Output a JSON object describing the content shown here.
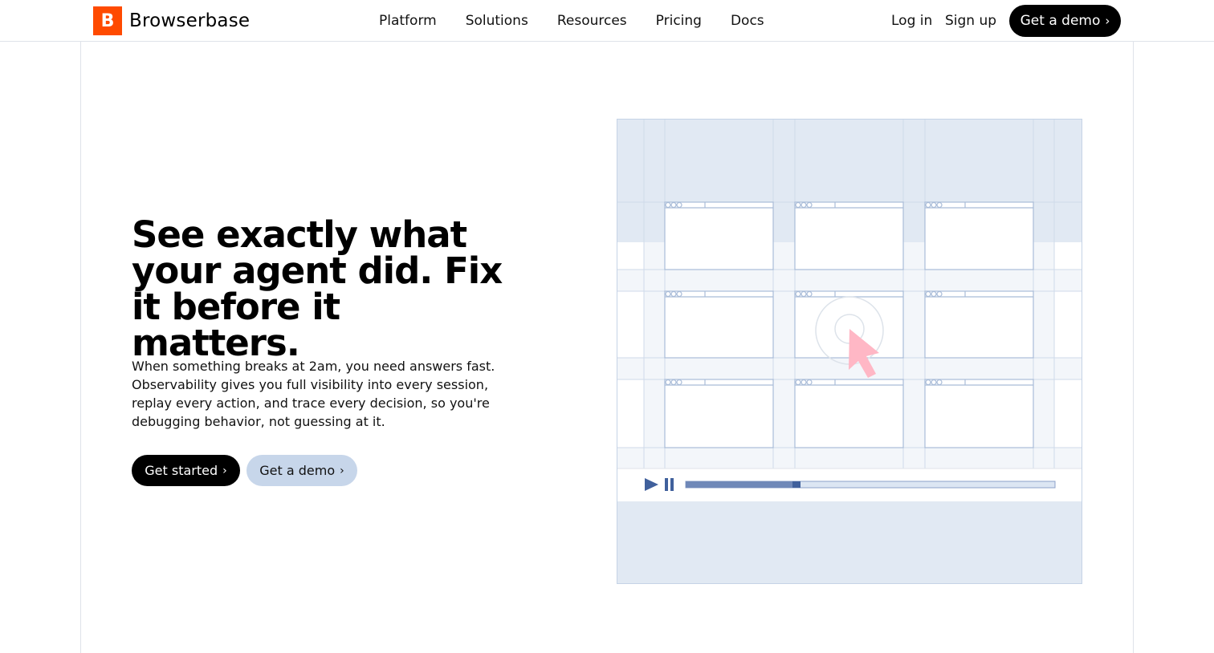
{
  "brand": {
    "mark": "B",
    "name": "Browserbase",
    "accent": "#ff4a00"
  },
  "nav": {
    "items": [
      {
        "label": "Platform"
      },
      {
        "label": "Solutions"
      },
      {
        "label": "Resources"
      },
      {
        "label": "Pricing"
      },
      {
        "label": "Docs"
      }
    ],
    "login_label": "Log in",
    "signup_label": "Sign up",
    "demo_label": "Get a demo"
  },
  "hero": {
    "headline": "See exactly what your agent did. Fix it before it matters.",
    "body": "When something breaks at 2am, you need answers fast. Observability gives you full visibility into every session, replay every action, and trace every decision, so you're debugging behavior, not guessing at it.",
    "primary_cta": "Get started",
    "secondary_cta": "Get a demo"
  },
  "player": {
    "progress": 0.31
  },
  "colors": {
    "illustration_bg": "#e1e9f3",
    "line": "#c5d3e6",
    "player_fill": "#6f88b8",
    "cursor": "#ffb7c5"
  },
  "icons": {
    "play": "play-icon",
    "pause": "pause-icon",
    "chevron": "chevron-right-icon",
    "cursor": "pointer-cursor-icon"
  }
}
